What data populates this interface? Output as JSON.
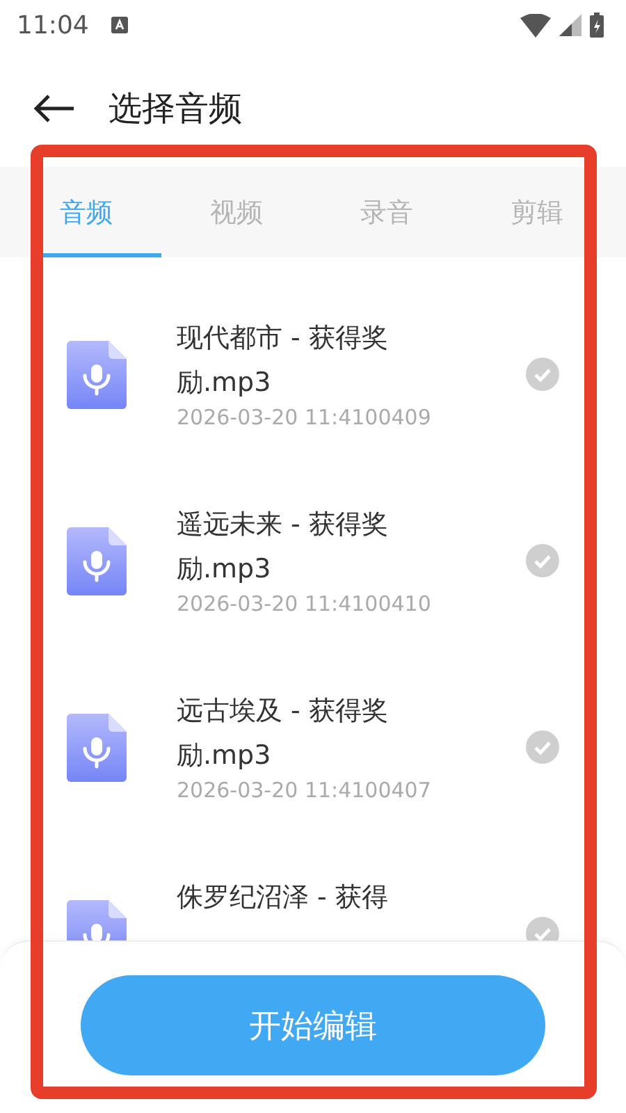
{
  "status_bar": {
    "time": "11:04"
  },
  "header": {
    "title": "选择音频"
  },
  "tabs": [
    {
      "label": "音频",
      "selected": true
    },
    {
      "label": "视频",
      "selected": false
    },
    {
      "label": "录音",
      "selected": false
    },
    {
      "label": "剪辑",
      "selected": false
    }
  ],
  "files": [
    {
      "name": "现代都市 - 获得奖励.mp3",
      "meta": "2026-03-20 11:4100409",
      "selected": false
    },
    {
      "name": "遥远未来 - 获得奖励.mp3",
      "meta": "2026-03-20 11:4100410",
      "selected": false
    },
    {
      "name": "远古埃及 - 获得奖励.mp3",
      "meta": "2026-03-20 11:4100407",
      "selected": false
    },
    {
      "name": "侏罗纪沼泽 - 获得",
      "selected": false
    }
  ],
  "primary_button": "开始编辑"
}
